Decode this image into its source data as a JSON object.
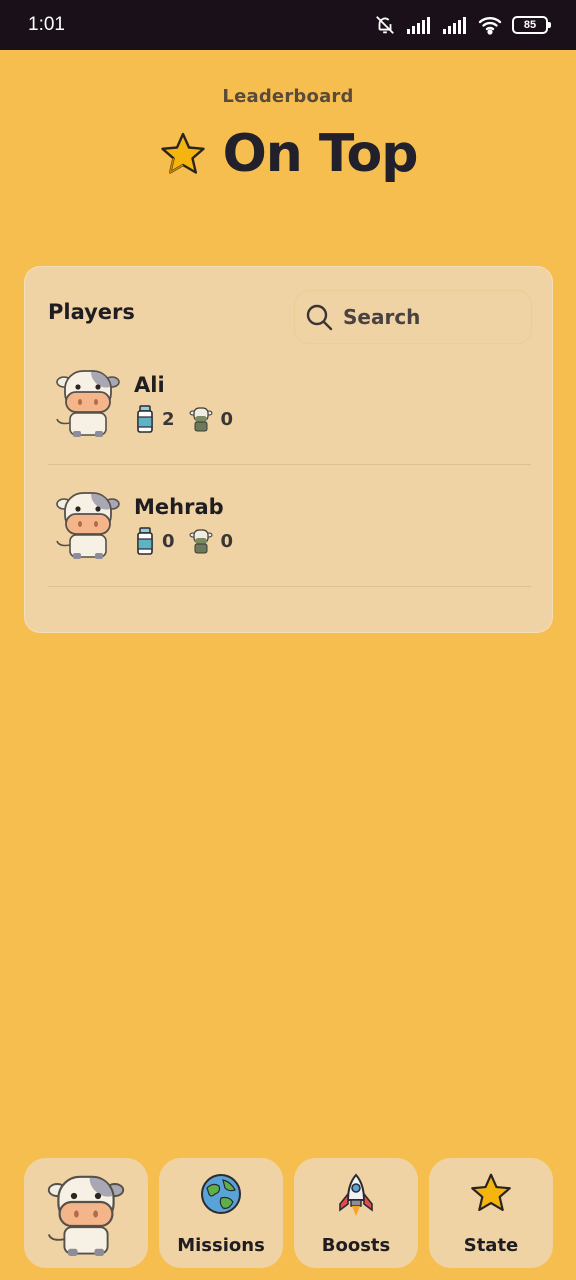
{
  "status_bar": {
    "time": "1:01",
    "battery": "85"
  },
  "header": {
    "subtitle": "Leaderboard",
    "title": "On Top"
  },
  "players_section": {
    "label": "Players",
    "search_placeholder": "Search",
    "players": [
      {
        "name": "Ali",
        "milk": "2",
        "cows": "0"
      },
      {
        "name": "Mehrab",
        "milk": "0",
        "cows": "0"
      }
    ]
  },
  "nav": {
    "missions_label": "Missions",
    "boosts_label": "Boosts",
    "state_label": "State"
  },
  "colors": {
    "background": "#F6BE4F",
    "card": "#EFD3A4",
    "status_bar": "#1a1019",
    "star": "#F5B50E"
  }
}
